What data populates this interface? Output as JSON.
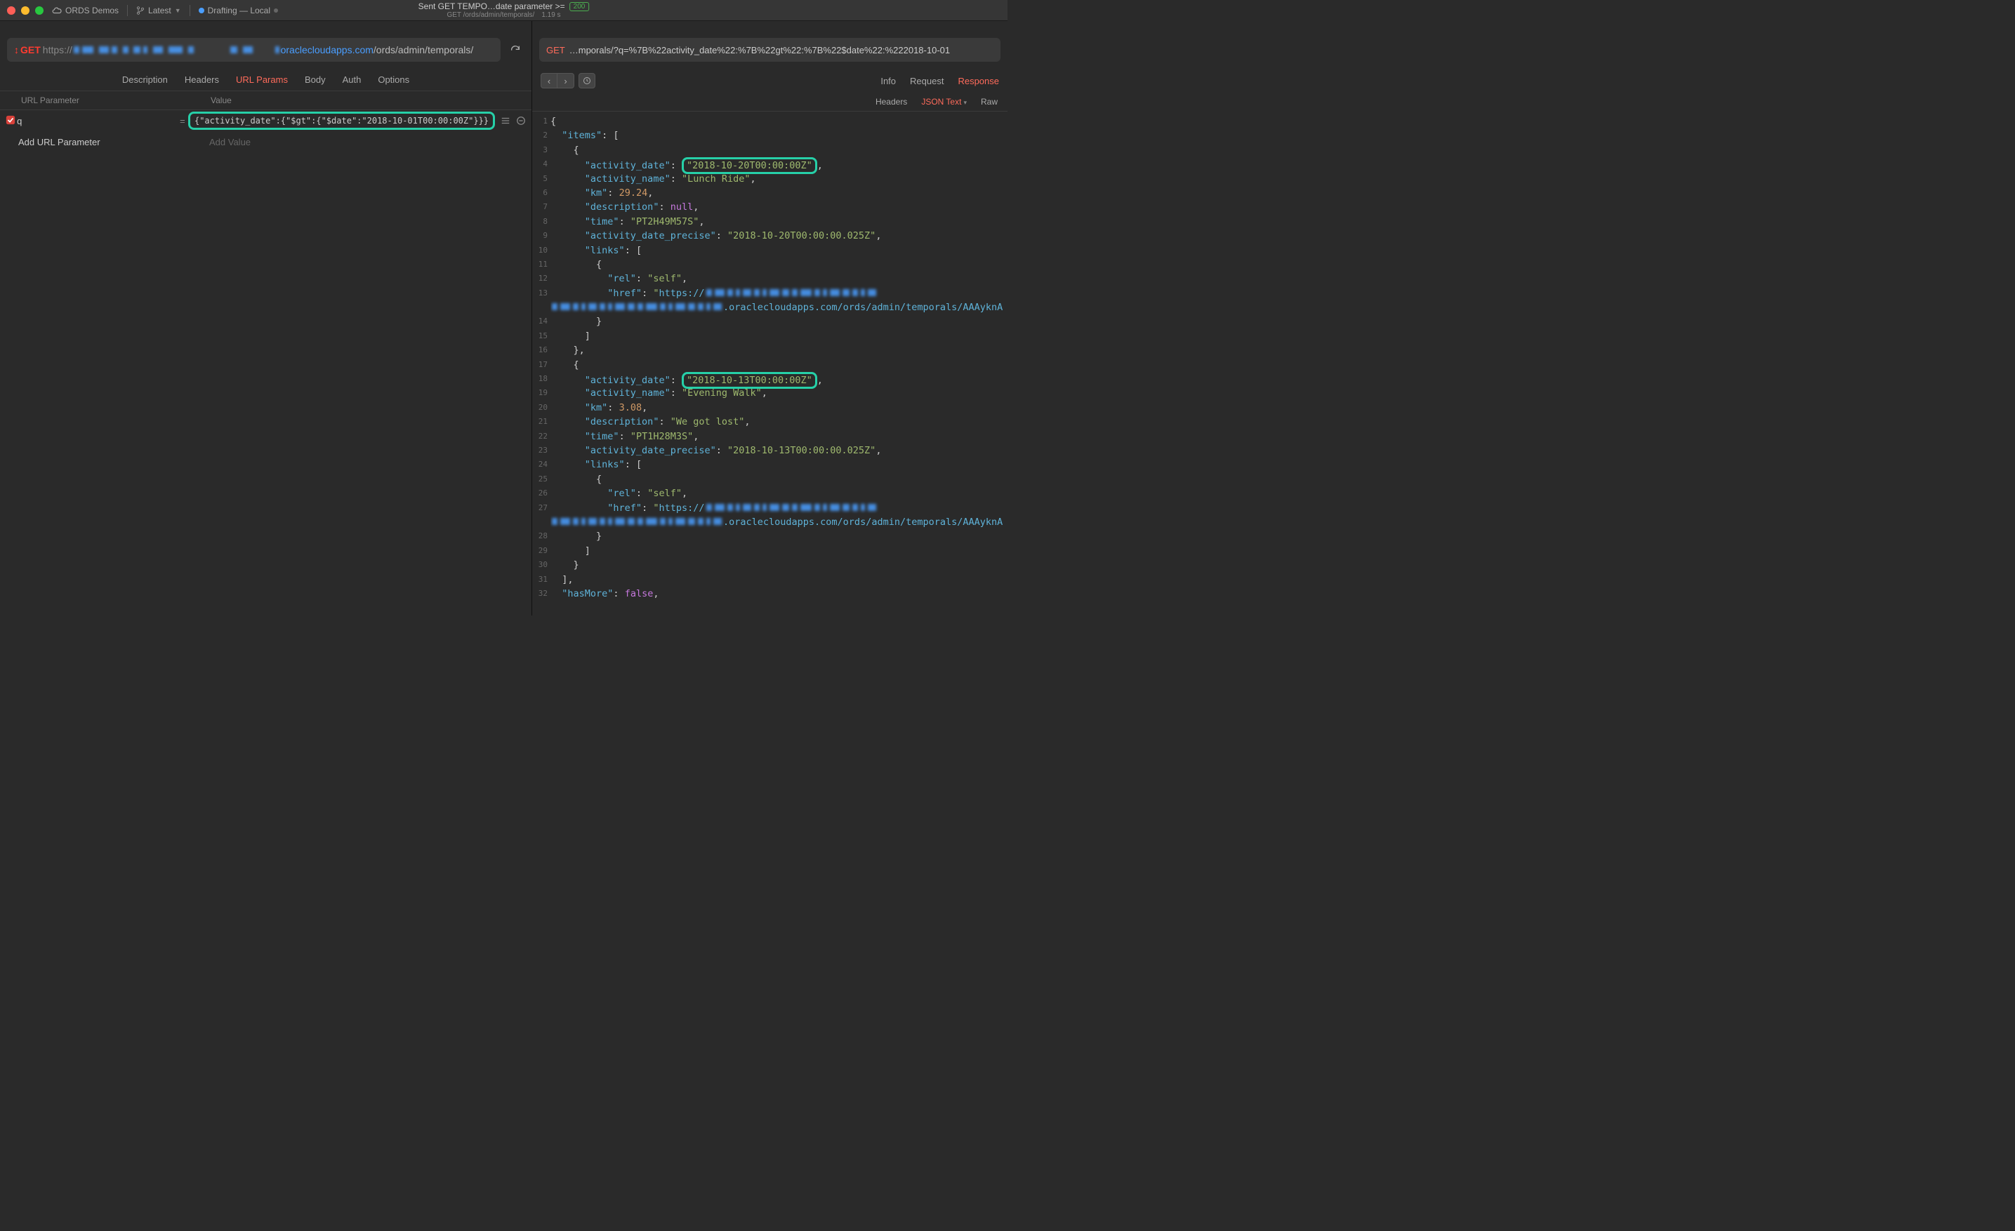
{
  "titlebar": {
    "project": "ORDS Demos",
    "branch": "Latest",
    "tab_label": "Drafting — Local",
    "center_line1": "Sent GET TEMPO…date parameter >=",
    "status_code": "200",
    "center_line2_left": "GET /ords/admin/temporals/",
    "center_line2_right": "1.19 s"
  },
  "request": {
    "method_prefix": "↕",
    "method": "GET",
    "url_proto": "https://",
    "url_highlight": "oraclecloudapps.com",
    "url_path": "/ords/admin/temporals/",
    "tabs": {
      "description": "Description",
      "headers": "Headers",
      "url_params": "URL Params",
      "body": "Body",
      "auth": "Auth",
      "options": "Options"
    },
    "params_header": {
      "name": "URL Parameter",
      "value": "Value"
    },
    "param": {
      "name": "q",
      "value": "{\"activity_date\":{\"$gt\":{\"$date\":\"2018-10-01T00:00:00Z\"}}}"
    },
    "add_param": "Add URL Parameter",
    "add_value": "Add Value"
  },
  "response": {
    "method": "GET",
    "url_tail": "…mporals/?q=%7B%22activity_date%22:%7B%22gt%22:%7B%22$date%22:%222018-10-01",
    "top_tabs": {
      "info": "Info",
      "request": "Request",
      "response": "Response"
    },
    "sub_tabs": {
      "headers": "Headers",
      "json": "JSON Text",
      "raw": "Raw"
    },
    "code_lines": [
      {
        "n": 1,
        "indent": 0,
        "type": "open",
        "text": "{"
      },
      {
        "n": 2,
        "indent": 1,
        "type": "kv",
        "key": "items",
        "after": ": ["
      },
      {
        "n": 3,
        "indent": 2,
        "type": "open",
        "text": "{"
      },
      {
        "n": 4,
        "indent": 3,
        "type": "kvstr",
        "key": "activity_date",
        "val": "2018-10-20T00:00:00Z",
        "hl": true,
        "comma": true
      },
      {
        "n": 5,
        "indent": 3,
        "type": "kvstr",
        "key": "activity_name",
        "val": "Lunch Ride",
        "comma": true
      },
      {
        "n": 6,
        "indent": 3,
        "type": "kvnum",
        "key": "km",
        "val": "29.24",
        "comma": true
      },
      {
        "n": 7,
        "indent": 3,
        "type": "kvnull",
        "key": "description",
        "comma": true
      },
      {
        "n": 8,
        "indent": 3,
        "type": "kvstr",
        "key": "time",
        "val": "PT2H49M57S",
        "comma": true
      },
      {
        "n": 9,
        "indent": 3,
        "type": "kvstr",
        "key": "activity_date_precise",
        "val": "2018-10-20T00:00:00.025Z",
        "comma": true
      },
      {
        "n": 10,
        "indent": 3,
        "type": "kv",
        "key": "links",
        "after": ": ["
      },
      {
        "n": 11,
        "indent": 4,
        "type": "open",
        "text": "{"
      },
      {
        "n": 12,
        "indent": 5,
        "type": "kvstr",
        "key": "rel",
        "val": "self",
        "comma": true
      },
      {
        "n": 13,
        "indent": 5,
        "type": "href",
        "key": "href",
        "prefix": "https://",
        "censored": true
      },
      {
        "n": "",
        "indent": 0,
        "type": "hrefwrap",
        "text": ".oraclecloudapps.com/ords/admin/temporals/AAAyknA"
      },
      {
        "n": 14,
        "indent": 4,
        "type": "close",
        "text": "}"
      },
      {
        "n": 15,
        "indent": 3,
        "type": "close",
        "text": "]"
      },
      {
        "n": 16,
        "indent": 2,
        "type": "close",
        "text": "},"
      },
      {
        "n": 17,
        "indent": 2,
        "type": "open",
        "text": "{"
      },
      {
        "n": 18,
        "indent": 3,
        "type": "kvstr",
        "key": "activity_date",
        "val": "2018-10-13T00:00:00Z",
        "hl": true,
        "comma": true
      },
      {
        "n": 19,
        "indent": 3,
        "type": "kvstr",
        "key": "activity_name",
        "val": "Evening Walk",
        "comma": true
      },
      {
        "n": 20,
        "indent": 3,
        "type": "kvnum",
        "key": "km",
        "val": "3.08",
        "comma": true
      },
      {
        "n": 21,
        "indent": 3,
        "type": "kvstr",
        "key": "description",
        "val": "We got lost",
        "comma": true
      },
      {
        "n": 22,
        "indent": 3,
        "type": "kvstr",
        "key": "time",
        "val": "PT1H28M3S",
        "comma": true
      },
      {
        "n": 23,
        "indent": 3,
        "type": "kvstr",
        "key": "activity_date_precise",
        "val": "2018-10-13T00:00:00.025Z",
        "comma": true
      },
      {
        "n": 24,
        "indent": 3,
        "type": "kv",
        "key": "links",
        "after": ": ["
      },
      {
        "n": 25,
        "indent": 4,
        "type": "open",
        "text": "{"
      },
      {
        "n": 26,
        "indent": 5,
        "type": "kvstr",
        "key": "rel",
        "val": "self",
        "comma": true
      },
      {
        "n": 27,
        "indent": 5,
        "type": "href",
        "key": "href",
        "prefix": "https://",
        "censored": true
      },
      {
        "n": "",
        "indent": 0,
        "type": "hrefwrap",
        "text": ".oraclecloudapps.com/ords/admin/temporals/AAAyknA"
      },
      {
        "n": 28,
        "indent": 4,
        "type": "close",
        "text": "}"
      },
      {
        "n": 29,
        "indent": 3,
        "type": "close",
        "text": "]"
      },
      {
        "n": 30,
        "indent": 2,
        "type": "close",
        "text": "}"
      },
      {
        "n": 31,
        "indent": 1,
        "type": "close",
        "text": "],"
      },
      {
        "n": 32,
        "indent": 1,
        "type": "kvbool",
        "key": "hasMore",
        "val": "false",
        "comma": true
      }
    ]
  }
}
